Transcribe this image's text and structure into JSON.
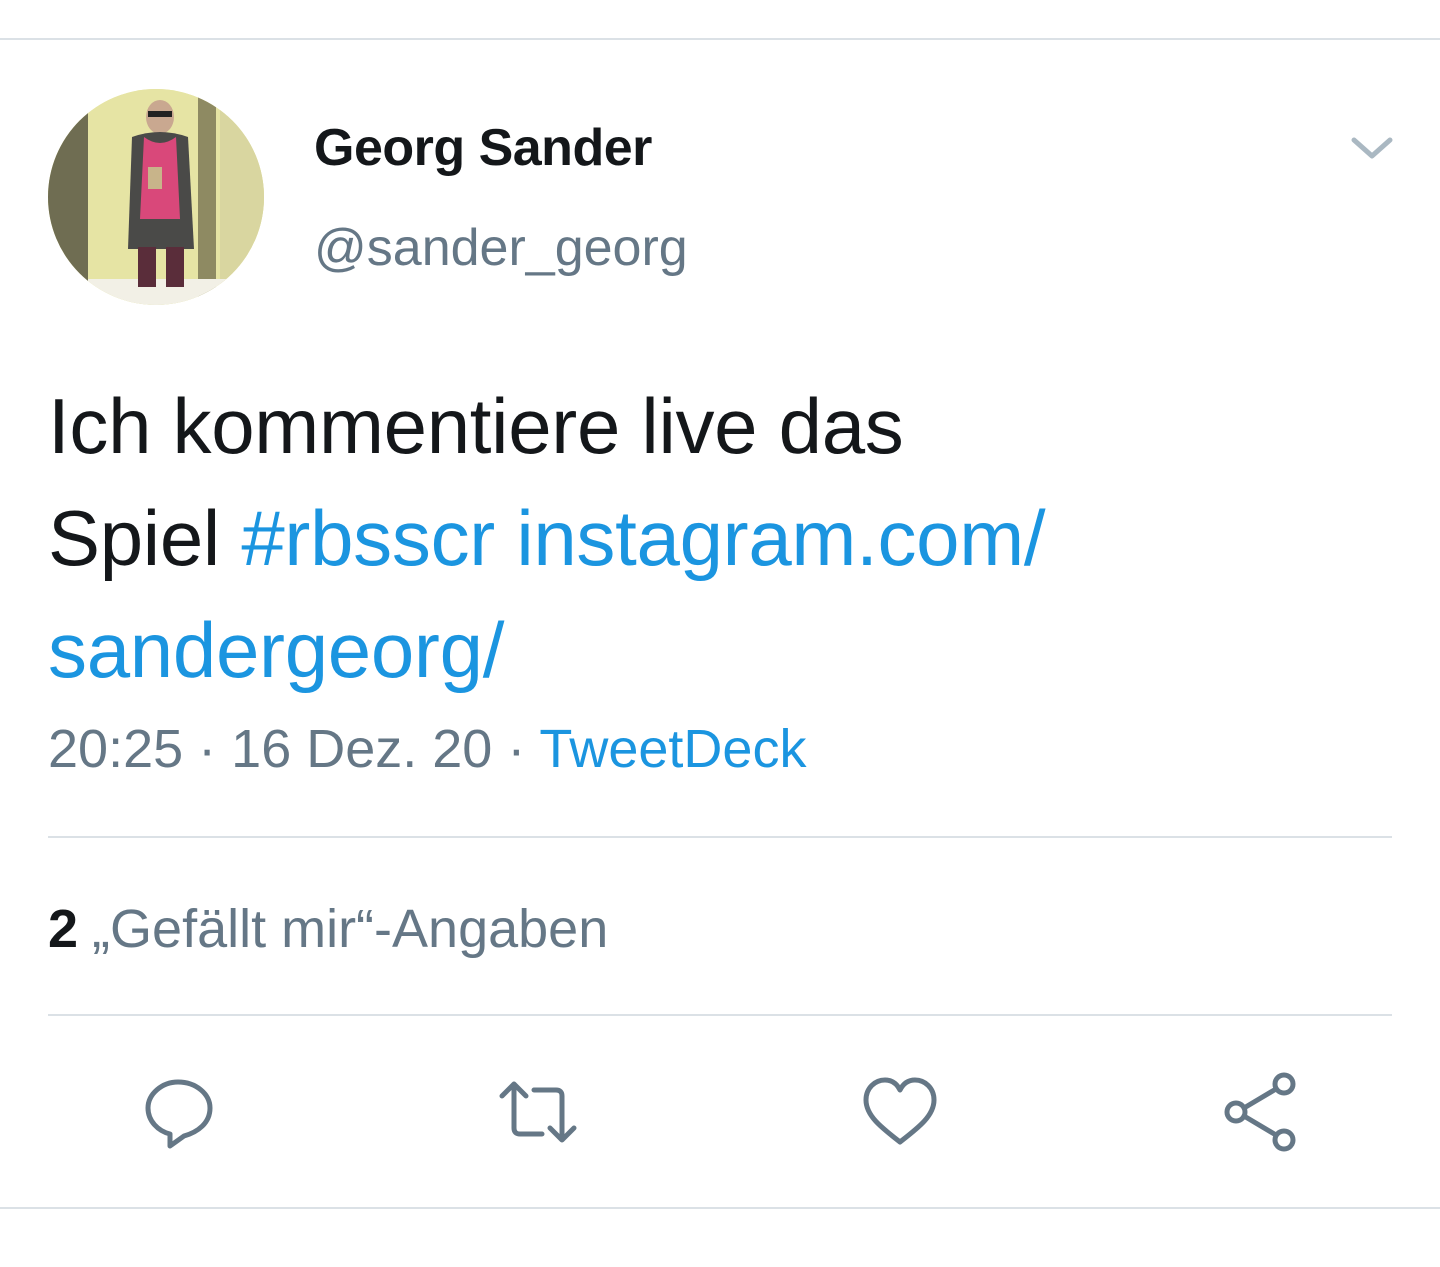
{
  "tweet": {
    "author": {
      "display_name": "Georg Sander",
      "handle": "@sander_georg",
      "avatar_icon": "user-avatar-photo"
    },
    "text": {
      "line1": "Ich kommentiere live das",
      "word_before_links": "Spiel",
      "hashtag": "#rbsscr",
      "url_part1": "instagram.com/",
      "url_part2": "sandergeorg/"
    },
    "time": "20:25",
    "date": "16 Dez. 20",
    "separator": "·",
    "source": "TweetDeck",
    "likes": {
      "count": "2",
      "label": "„Gefällt mir“-Angaben"
    }
  },
  "icons": {
    "menu": "chevron-down-icon",
    "reply": "reply-bubble-icon",
    "retweet": "retweet-icon",
    "like": "heart-icon",
    "share": "share-icon"
  },
  "colors": {
    "link": "#1b95e0",
    "secondary_text": "#657786",
    "primary_text": "#14171a",
    "divider": "#dbe1e6",
    "icon": "#657786"
  }
}
